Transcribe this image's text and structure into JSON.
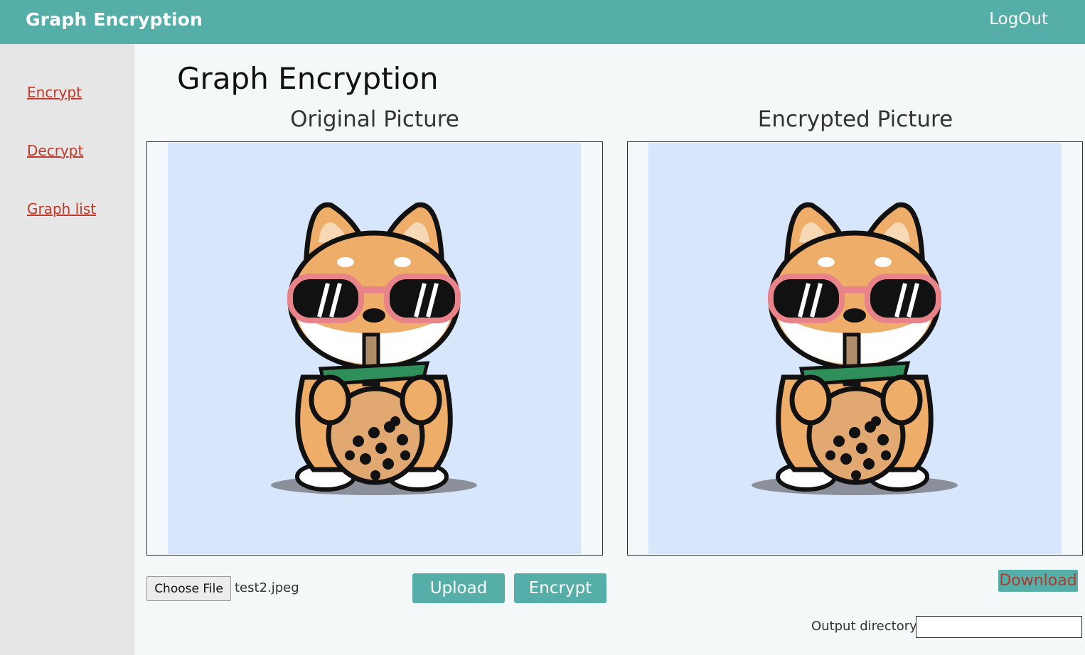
{
  "header": {
    "brand": "Graph Encryption",
    "logout_label": "LogOut"
  },
  "sidebar": {
    "items": [
      {
        "label": "Encrypt"
      },
      {
        "label": "Decrypt"
      },
      {
        "label": "Graph list"
      }
    ]
  },
  "main": {
    "title": "Graph Encryption",
    "original": {
      "title": "Original Picture"
    },
    "encrypted": {
      "title": "Encrypted Picture"
    },
    "choose_file_label": "Choose File",
    "file_name": "test2.jpeg",
    "upload_label": "Upload",
    "encrypt_label": "Encrypt",
    "download_label": "Download",
    "output_dir_label": "Output directory",
    "output_dir_value": ""
  },
  "colors": {
    "accent": "#55afa8",
    "link": "#c0392b",
    "image_bg": "#d7e6fb",
    "sidebar_bg": "#e6e6e6"
  },
  "icons": {
    "picture": "shiba-inu-with-sunglasses-drinking-boba"
  }
}
